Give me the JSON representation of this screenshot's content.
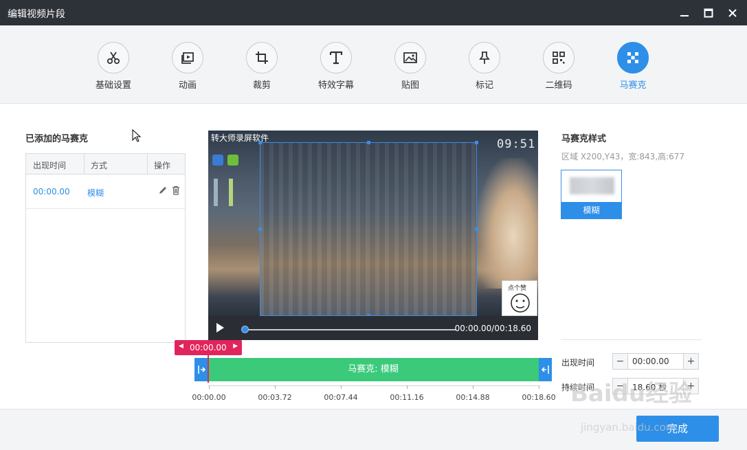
{
  "window": {
    "title": "编辑视频片段"
  },
  "tools": [
    {
      "label": "基础设置",
      "icon": "scissors-icon"
    },
    {
      "label": "动画",
      "icon": "animation-icon"
    },
    {
      "label": "裁剪",
      "icon": "crop-icon"
    },
    {
      "label": "特效字幕",
      "icon": "text-icon"
    },
    {
      "label": "贴图",
      "icon": "image-icon"
    },
    {
      "label": "标记",
      "icon": "pin-icon"
    },
    {
      "label": "二维码",
      "icon": "qrcode-icon"
    },
    {
      "label": "马赛克",
      "icon": "mosaic-icon",
      "active": true
    }
  ],
  "left_panel": {
    "title": "已添加的马赛克",
    "columns": [
      "出现时间",
      "方式",
      "操作"
    ],
    "rows": [
      {
        "time": "00:00.00",
        "mode": "模糊"
      }
    ]
  },
  "video": {
    "overlay_brand": "转大师录屏软件",
    "clock": "09:51",
    "sticker_text": "点个赞",
    "timecode": "00:00.00/00:18.60",
    "progress": 0
  },
  "right_panel": {
    "title": "马赛克样式",
    "region": "区域 X200,Y43，宽:843,高:677",
    "style_label": "模糊",
    "appear_label": "出现时间",
    "appear_value": "00:00.00",
    "duration_label": "持续时间",
    "duration_value": "18.60 秒"
  },
  "timeline": {
    "marker_time": "00:00.00",
    "clip_label": "马赛克: 模糊",
    "ticks": [
      "00:00.00",
      "00:03.72",
      "00:07.44",
      "00:11.16",
      "00:14.88",
      "00:18.60"
    ]
  },
  "footer": {
    "done_label": "完成"
  },
  "watermark": {
    "logo": "Baidu经验",
    "url": "jingyan.baidu.com"
  },
  "colors": {
    "accent": "#2d8fe8",
    "clip": "#3bc97a",
    "marker": "#e2245c",
    "titlebar": "#2d3138"
  }
}
